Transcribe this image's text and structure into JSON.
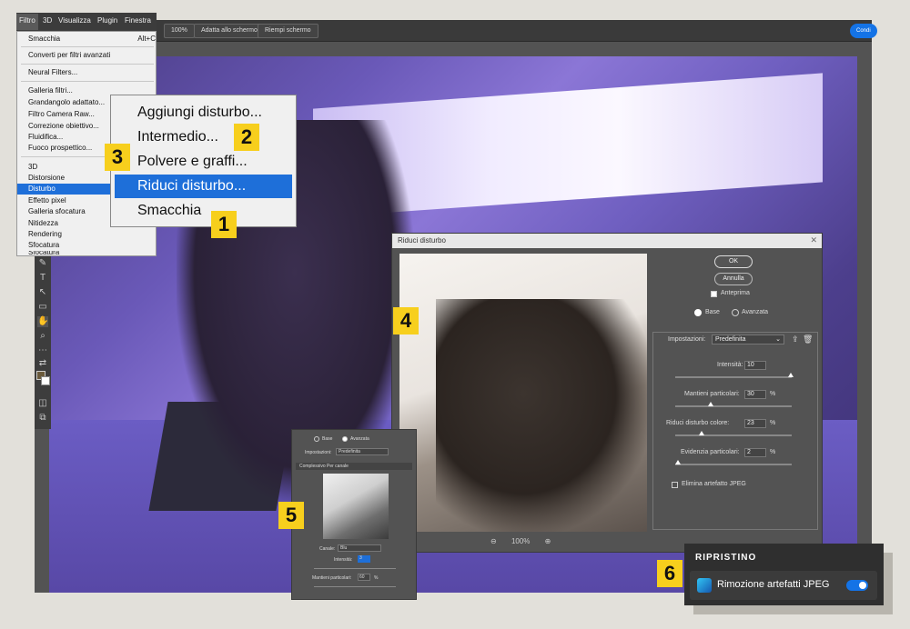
{
  "options_bar": {
    "zoom_100": "100%",
    "fit_screen": "Adatta allo schermo",
    "fill_screen": "Riempi schermo",
    "share": "Condi"
  },
  "menubar": {
    "items": [
      "Filtro",
      "3D",
      "Visualizza",
      "Plugin",
      "Finestra"
    ]
  },
  "filter_menu": {
    "last_filter": "Smacchia",
    "last_filter_shortcut": "Alt+C",
    "convert": "Converti per filtri avanzati",
    "neural": "Neural Filters...",
    "group1": [
      "Galleria filtri...",
      "Grandangolo adattato...",
      "Filtro Camera Raw...",
      "Correzione obiettivo...",
      "Fluidifica...",
      "Fuoco prospettico..."
    ],
    "group2": [
      "3D",
      "Distorsione",
      "Disturbo",
      "Effetto pixel",
      "Galleria sfocatura",
      "Nitidezza",
      "Rendering",
      "Sfocatura",
      "Sfocatura"
    ],
    "selected": "Disturbo"
  },
  "noise_submenu": {
    "items": [
      "Aggiungi disturbo...",
      "Intermedio...",
      "Polvere e graffi...",
      "Riduci disturbo...",
      "Smacchia"
    ],
    "selected": "Riduci disturbo..."
  },
  "badges": {
    "b1": "1",
    "b2": "2",
    "b3": "3",
    "b4": "4",
    "b5": "5",
    "b6": "6"
  },
  "rd_dialog": {
    "title": "Riduci disturbo",
    "ok": "OK",
    "cancel": "Annulla",
    "preview": "Anteprima",
    "mode_base": "Base",
    "mode_advanced": "Avanzata",
    "settings_label": "Impostazioni:",
    "preset": "Predefinita",
    "intensity_label": "Intensità:",
    "intensity_value": "10",
    "preserve_label": "Mantieni particolari:",
    "preserve_value": "30",
    "color_noise_label": "Riduci disturbo colore:",
    "color_noise_value": "23",
    "sharpen_label": "Evidenzia particolari:",
    "sharpen_value": "2",
    "percent": "%",
    "jpeg_label": "Elimina artefatto JPEG",
    "zoom": "100%",
    "zoom_out": "⊖",
    "zoom_in": "⊕"
  },
  "adv_panel": {
    "mode_base": "Base",
    "mode_advanced": "Avanzata",
    "settings_label": "Impostazioni:",
    "preset": "Predefinita",
    "tab_overall": "Complessivo",
    "tab_channel": "Per canale",
    "channel_label": "Canale:",
    "channel_value": "Blu",
    "intensity_label": "Intensità:",
    "intensity_value": "3",
    "preserve_label": "Mantieni particolari:",
    "preserve_value": "60",
    "percent": "%"
  },
  "ripristino": {
    "title": "RIPRISTINO",
    "item_label": "Rimozione artefatti JPEG",
    "enabled": true
  },
  "colors": {
    "accent": "#1473e6",
    "badge": "#f7cf1d",
    "menu_selected": "#1e6fd9"
  }
}
